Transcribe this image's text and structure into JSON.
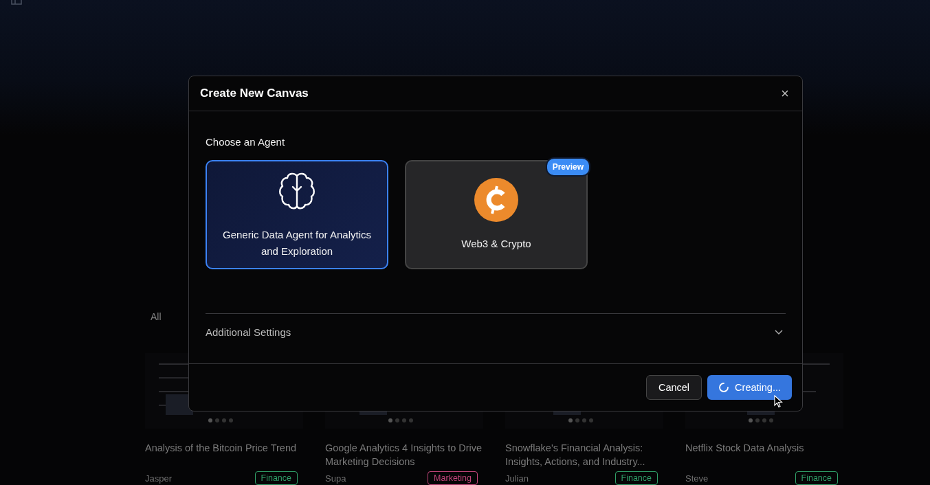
{
  "background_page": {
    "filter_tab": "All",
    "cards": [
      {
        "title": "Analysis of the Bitcoin Price Trend",
        "author": "Jasper",
        "tag": "Finance",
        "color": "#2f9e68"
      },
      {
        "title": "Google Analytics 4 Insights to Drive Marketing Decisions",
        "author": "Supa",
        "tag": "Marketing",
        "color": "#c2457a"
      },
      {
        "title": "Snowflake's Financial Analysis: Insights, Actions, and Industry...",
        "author": "Julian",
        "tag": "Finance",
        "color": "#2f9e68"
      },
      {
        "title": "Netflix Stock Data Analysis",
        "author": "Steve",
        "tag": "Finance",
        "color": "#2f9e68"
      }
    ]
  },
  "dialog": {
    "title": "Create New Canvas",
    "section_label": "Choose an Agent",
    "agents": [
      {
        "name": "Generic Data Agent for Analytics and Exploration",
        "kind": "brain",
        "selected": true
      },
      {
        "name": "Web3 & Crypto",
        "kind": "crypto",
        "selected": false,
        "badge": "Preview"
      }
    ],
    "additional_settings": {
      "label": "Additional Settings",
      "expanded": false
    },
    "cancel_button": "Cancel",
    "create_button": {
      "label": "Creating...",
      "loading": true
    }
  }
}
